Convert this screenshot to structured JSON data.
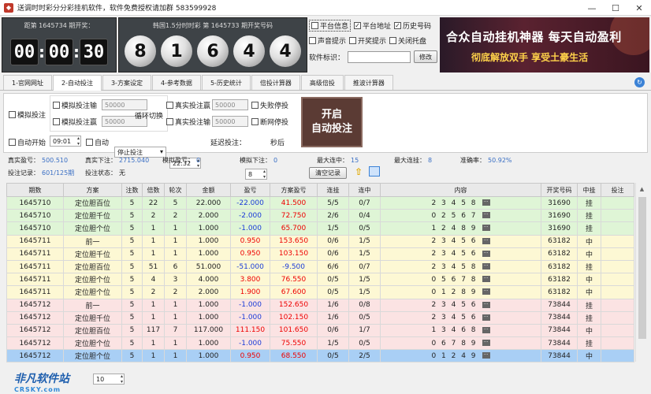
{
  "window": {
    "title": "送调时时彩分分彩挂机软件，软件免费授权请加群 583599928",
    "minimize": "—",
    "maximize": "☐",
    "close": "✕"
  },
  "countdown": {
    "header": "距第 1645734 期开奖：",
    "h": "00",
    "m": "00",
    "s": "30"
  },
  "draw": {
    "header": "韩国1.5分时时彩 第 1645733 期开奖号码",
    "balls": [
      "8",
      "1",
      "6",
      "4",
      "4"
    ]
  },
  "options": {
    "platform_info": "平台信息",
    "platform_addr": "平台地址",
    "history_nums": "历史号码",
    "sound_prompt": "声音提示",
    "draw_prompt": "开奖提示",
    "close_tray": "关闭托盘",
    "software_id_label": "软件标识：",
    "software_id_value": "",
    "modify_btn": "修改"
  },
  "banner": {
    "line1": "合众自动挂机神器  每天自动盈利",
    "line2": "彻底解放双手 享受土豪生活"
  },
  "tabs": [
    "1-官网网址",
    "2-自动投注",
    "3-方案设定",
    "4-参考数据",
    "5-历史统计",
    "倍投计算器",
    "高级倍投",
    "推波计算器"
  ],
  "control": {
    "sim_bet": "模拟投注",
    "sim_bet_loss": "模拟投注输",
    "sim_bet_loss_val": "50000",
    "sim_bet_win": "模拟投注赢",
    "sim_bet_win_val": "50000",
    "loop_switch": "循环切换",
    "real_bet_win": "真实投注赢",
    "real_bet_win_val": "50000",
    "real_bet_loss": "真实投注输",
    "real_bet_loss_val": "50000",
    "fail_stop": "失败停投",
    "disconnect_stop": "断网停投",
    "start_btn_l1": "开启",
    "start_btn_l2": "自动投注",
    "auto_start": "自动开始",
    "auto_start_time": "09:01",
    "auto": "自动",
    "stop_mode": "停止投注",
    "stop_time": "22:32",
    "delay_label": "延迟投注：",
    "delay_val": "8",
    "seconds": "秒后"
  },
  "stats": {
    "real_profit_label": "真实盈亏：",
    "real_profit": "500.510",
    "real_bet_label": "真实下注：",
    "real_bet": "2715.040",
    "sim_profit_label": "模拟盈亏：",
    "sim_profit": "0",
    "sim_bet_label": "模拟下注：",
    "sim_bet": "0",
    "max_win_streak_label": "最大连中：",
    "max_win_streak": "15",
    "max_loss_streak_label": "最大连挂：",
    "max_loss_streak": "8",
    "accuracy_label": "准确率：",
    "accuracy": "50.92%",
    "bet_record_label": "投注记录：",
    "bet_record": "601/125期",
    "bet_status_label": "投注状态：",
    "bet_status": "无",
    "clear_btn": "清空记录"
  },
  "table": {
    "headers": [
      "期数",
      "方案",
      "注数",
      "倍数",
      "轮次",
      "金额",
      "盈亏",
      "方案盈亏",
      "连挂",
      "连中",
      "内容",
      "开奖号码",
      "中挂",
      "投注"
    ],
    "rows": [
      {
        "cls": "green",
        "cells": [
          "1645710",
          "定位胆百位",
          "5",
          "22",
          "5",
          "22.000",
          "-22.000",
          "41.500",
          "5/5",
          "0/7",
          "2 3 4 5 8",
          "31690",
          "挂",
          ""
        ]
      },
      {
        "cls": "green",
        "cells": [
          "1645710",
          "定位胆千位",
          "5",
          "2",
          "2",
          "2.000",
          "-2.000",
          "72.750",
          "2/6",
          "0/4",
          "0 2 5 6 7",
          "31690",
          "挂",
          ""
        ]
      },
      {
        "cls": "green",
        "cells": [
          "1645710",
          "定位胆个位",
          "5",
          "1",
          "1",
          "1.000",
          "-1.000",
          "65.700",
          "1/5",
          "0/5",
          "1 2 4 8 9",
          "31690",
          "挂",
          ""
        ]
      },
      {
        "cls": "yellow",
        "cells": [
          "1645711",
          "前一",
          "5",
          "1",
          "1",
          "1.000",
          "0.950",
          "153.650",
          "0/6",
          "1/5",
          "2 3 4 5 6",
          "63182",
          "中",
          ""
        ]
      },
      {
        "cls": "yellow",
        "cells": [
          "1645711",
          "定位胆千位",
          "5",
          "1",
          "1",
          "1.000",
          "0.950",
          "103.150",
          "0/6",
          "1/5",
          "2 3 4 5 6",
          "63182",
          "中",
          ""
        ]
      },
      {
        "cls": "yellow",
        "cells": [
          "1645711",
          "定位胆百位",
          "5",
          "51",
          "6",
          "51.000",
          "-51.000",
          "-9.500",
          "6/6",
          "0/7",
          "2 3 4 5 8",
          "63182",
          "挂",
          ""
        ]
      },
      {
        "cls": "yellow",
        "cells": [
          "1645711",
          "定位胆个位",
          "5",
          "4",
          "3",
          "4.000",
          "3.800",
          "76.550",
          "0/5",
          "1/5",
          "0 5 6 7 8",
          "63182",
          "中",
          ""
        ]
      },
      {
        "cls": "yellow",
        "cells": [
          "1645711",
          "定位胆个位",
          "5",
          "2",
          "2",
          "2.000",
          "1.900",
          "67.600",
          "0/5",
          "1/5",
          "0 1 2 8 9",
          "63182",
          "中",
          ""
        ]
      },
      {
        "cls": "pink",
        "cells": [
          "1645712",
          "前一",
          "5",
          "1",
          "1",
          "1.000",
          "-1.000",
          "152.650",
          "1/6",
          "0/8",
          "2 3 4 5 6",
          "73844",
          "挂",
          ""
        ]
      },
      {
        "cls": "pink",
        "cells": [
          "1645712",
          "定位胆千位",
          "5",
          "1",
          "1",
          "1.000",
          "-1.000",
          "102.150",
          "1/6",
          "0/5",
          "2 3 4 5 6",
          "73844",
          "挂",
          ""
        ]
      },
      {
        "cls": "pink",
        "cells": [
          "1645712",
          "定位胆百位",
          "5",
          "117",
          "7",
          "117.000",
          "111.150",
          "101.650",
          "0/6",
          "1/7",
          "1 3 4 6 8",
          "73844",
          "中",
          ""
        ]
      },
      {
        "cls": "pink",
        "cells": [
          "1645712",
          "定位胆个位",
          "5",
          "1",
          "1",
          "1.000",
          "-1.000",
          "75.550",
          "1/5",
          "0/5",
          "0 6 7 8 9",
          "73844",
          "挂",
          ""
        ]
      },
      {
        "cls": "sel",
        "cells": [
          "1645712",
          "定位胆个位",
          "5",
          "1",
          "1",
          "1.000",
          "0.950",
          "68.550",
          "0/5",
          "2/5",
          "0 1 2 4 9",
          "73844",
          "中",
          ""
        ]
      }
    ]
  },
  "bottom": {
    "watermark1": "非凡软件站",
    "watermark2": "CRSKY.com",
    "page_size": "10"
  }
}
